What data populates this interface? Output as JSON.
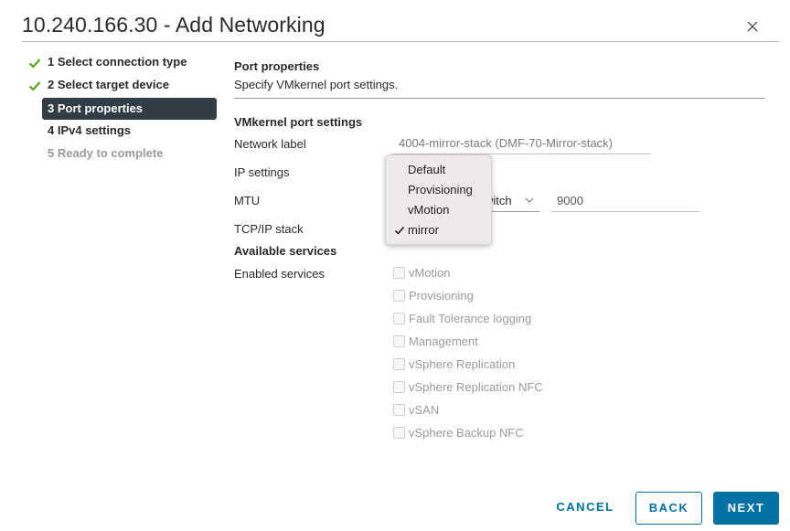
{
  "dialog": {
    "title": "10.240.166.30 - Add Networking"
  },
  "steps": [
    {
      "label": "1 Select connection type",
      "state": "done"
    },
    {
      "label": "2 Select target device",
      "state": "done"
    },
    {
      "label": "3 Port properties",
      "state": "active"
    },
    {
      "label": "4 IPv4 settings",
      "state": "pending"
    },
    {
      "label": "5 Ready to complete",
      "state": "disabled"
    }
  ],
  "content": {
    "heading": "Port properties",
    "description": "Specify VMkernel port settings.",
    "settings_heading": "VMkernel port settings",
    "fields": {
      "network_label": {
        "label": "Network label",
        "value": "4004-mirror-stack (DMF-70-Mirror-stack)"
      },
      "ip_settings": {
        "label": "IP settings"
      },
      "mtu": {
        "label": "MTU",
        "select_value": "witch",
        "input_value": "9000"
      },
      "tcpip_stack": {
        "label": "TCP/IP stack"
      }
    },
    "tcpip_dropdown": {
      "options": [
        "Default",
        "Provisioning",
        "vMotion",
        "mirror"
      ],
      "selected": "mirror",
      "check_glyph": "✓"
    },
    "services_heading": "Available services",
    "enabled_services_label": "Enabled services",
    "services": [
      {
        "label": "vMotion",
        "checked": false,
        "disabled": true
      },
      {
        "label": "Provisioning",
        "checked": false,
        "disabled": true
      },
      {
        "label": "Fault Tolerance logging",
        "checked": false,
        "disabled": true
      },
      {
        "label": "Management",
        "checked": false,
        "disabled": true
      },
      {
        "label": "vSphere Replication",
        "checked": false,
        "disabled": true
      },
      {
        "label": "vSphere Replication NFC",
        "checked": false,
        "disabled": true
      },
      {
        "label": "vSAN",
        "checked": false,
        "disabled": true
      },
      {
        "label": "vSphere Backup NFC",
        "checked": false,
        "disabled": true
      }
    ]
  },
  "footer": {
    "cancel_label": "CANCEL",
    "back_label": "BACK",
    "next_label": "NEXT"
  },
  "icons": {
    "close": "close-icon",
    "check": "check-icon",
    "chevron": "chevron-down-icon"
  },
  "colors": {
    "accent": "#0072a3",
    "active_step_bg": "#313c45",
    "check_green": "#5aa220"
  }
}
